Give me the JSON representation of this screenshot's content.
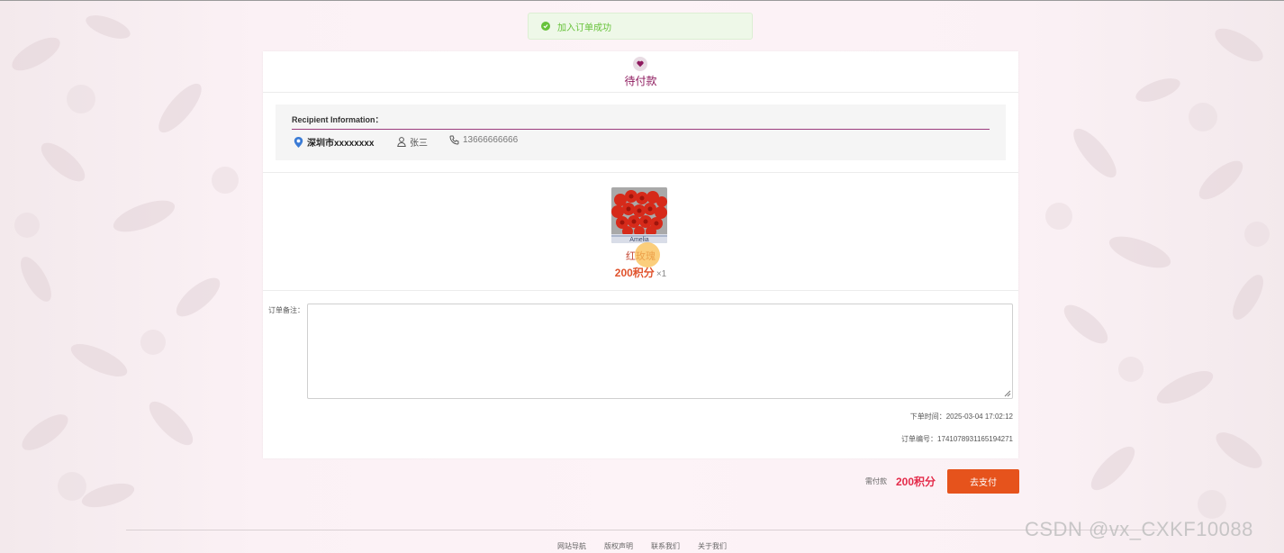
{
  "toast": {
    "message": "加入订单成功",
    "color": "#67c23a"
  },
  "order": {
    "status": "待付款",
    "recipient": {
      "title": "Recipient Information：",
      "address": "深圳市xxxxxxxx",
      "name": "张三",
      "phone": "13666666666"
    },
    "product": {
      "name": "红玫瑰",
      "price": "200积分",
      "quantity": "×1",
      "image_caption": "Amelia"
    },
    "note": {
      "label": "订单备注：",
      "value": ""
    },
    "order_time": "下单时间：2025-03-04 17:02:12",
    "order_number": "订单编号：1741078931165194271"
  },
  "payment": {
    "label": "需付款",
    "amount": "200积分",
    "button_label": "去支付",
    "button_color": "#e6531c"
  },
  "footer": {
    "links": [
      "网站导航",
      "版权声明",
      "联系我们",
      "关于我们"
    ]
  },
  "watermark": "CSDN @vx_CXKF10088",
  "icons": {
    "toast": "check-circle-icon",
    "status": "heart-icon",
    "address": "location-pin-icon",
    "person": "user-icon",
    "phone": "phone-icon"
  }
}
